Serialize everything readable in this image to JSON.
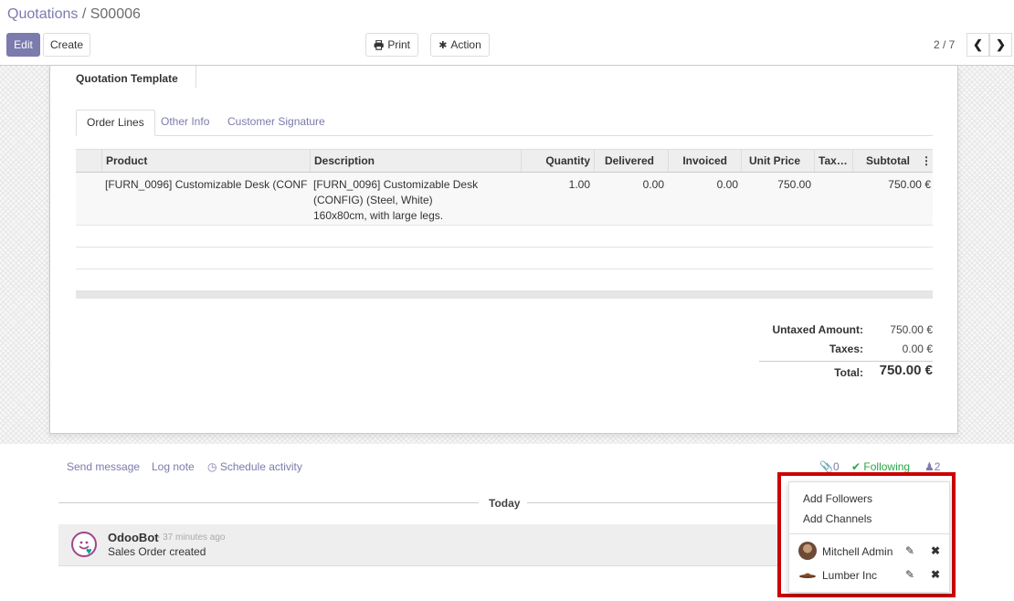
{
  "breadcrumb": {
    "parent": "Quotations",
    "separator": " / ",
    "current": "S00006"
  },
  "toolbar": {
    "edit": "Edit",
    "create": "Create",
    "print": "Print",
    "action": "Action"
  },
  "pager": {
    "value": "2 / 7"
  },
  "form": {
    "template_label": "Quotation Template",
    "tabs": [
      "Order Lines",
      "Other Info",
      "Customer Signature"
    ],
    "columns": [
      "Product",
      "Description",
      "Quantity",
      "Delivered",
      "Invoiced",
      "Unit Price",
      "Tax…",
      "Subtotal"
    ],
    "line": {
      "product": "[FURN_0096] Customizable Desk (CONF…",
      "description_1": "[FURN_0096] Customizable Desk",
      "description_2": "(CONFIG) (Steel, White)",
      "description_3": "160x80cm, with large legs.",
      "quantity": "1.00",
      "delivered": "0.00",
      "invoiced": "0.00",
      "unit_price": "750.00",
      "taxes": "",
      "subtotal": "750.00 €"
    },
    "totals": {
      "untaxed_label": "Untaxed Amount:",
      "untaxed": "750.00 €",
      "taxes_label": "Taxes:",
      "taxes": "0.00 €",
      "total_label": "Total:",
      "total": "750.00 €"
    }
  },
  "chatter": {
    "send_message": "Send message",
    "log_note": "Log note",
    "schedule_activity": "Schedule activity",
    "attachments_count": "0",
    "following": "Following",
    "followers_count": "2",
    "date_separator": "Today",
    "message": {
      "author": "OdooBot",
      "time": "- 37 minutes ago",
      "body": "Sales Order created"
    }
  },
  "followers_dropdown": {
    "add_followers": "Add Followers",
    "add_channels": "Add Channels",
    "followers": [
      {
        "name": "Mitchell Admin"
      },
      {
        "name": "Lumber Inc"
      }
    ]
  },
  "colors": {
    "brand": "#7c7bad",
    "following": "#28a745",
    "highlight": "#cc0000"
  }
}
